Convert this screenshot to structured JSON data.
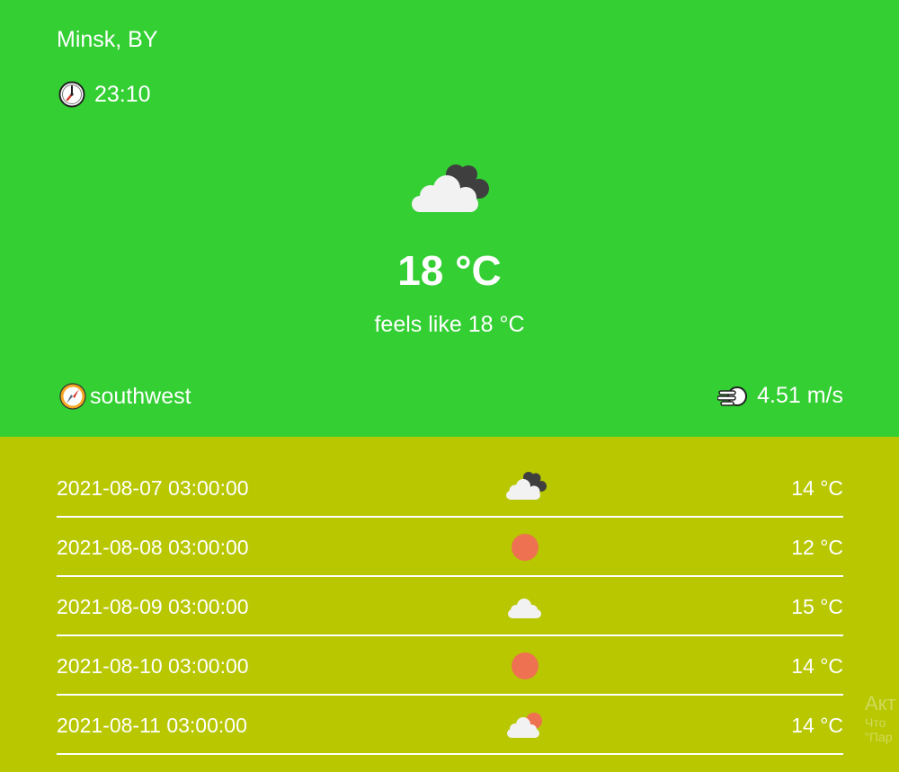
{
  "location": {
    "city": "Minsk, BY",
    "icon": "clock-icon",
    "time": "23:10"
  },
  "current": {
    "icon": "cloudy-night-icon",
    "temperature": "18 °C",
    "feels_like": "feels like 18 °C",
    "wind_direction": "southwest",
    "wind_direction_icon": "compass-icon",
    "wind_speed": "4.51 m/s",
    "wind_speed_icon": "wind-icon"
  },
  "forecast": [
    {
      "date": "2021-08-07 03:00:00",
      "icon": "cloudy-night-icon",
      "temp": "14 °C"
    },
    {
      "date": "2021-08-08 03:00:00",
      "icon": "sun-icon",
      "temp": "12 °C"
    },
    {
      "date": "2021-08-09 03:00:00",
      "icon": "cloud-icon",
      "temp": "15 °C"
    },
    {
      "date": "2021-08-10 03:00:00",
      "icon": "sun-icon",
      "temp": "14 °C"
    },
    {
      "date": "2021-08-11 03:00:00",
      "icon": "partly-cloudy-icon",
      "temp": "14 °C"
    }
  ],
  "watermark": {
    "line1": "Акт",
    "line2": "Что",
    "line3": "\"Пар"
  },
  "colors": {
    "top_bg": "#33cf33",
    "bottom_bg": "#b8c700",
    "sun": "#ee7152",
    "cloud": "#f2f2f2",
    "dark_cloud": "#3f3f3f"
  }
}
